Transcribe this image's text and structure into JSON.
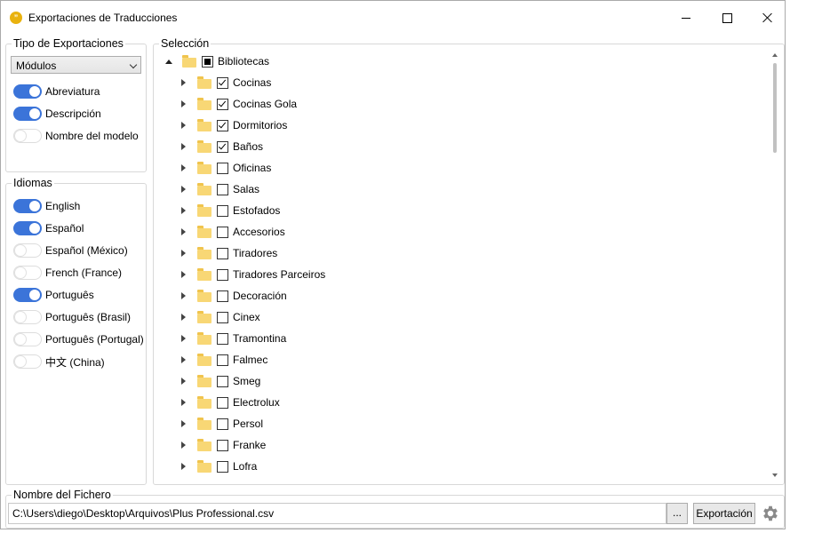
{
  "window": {
    "title": "Exportaciones de Traducciones",
    "icon": "quote-bubble-icon",
    "controls": {
      "minimize": "minimize-icon",
      "maximize": "maximize-icon",
      "close": "close-icon"
    }
  },
  "tipo": {
    "legend": "Tipo de Exportaciones",
    "select_value": "Módulos",
    "options": [
      {
        "label": "Abreviatura",
        "on": true
      },
      {
        "label": "Descripción",
        "on": true
      },
      {
        "label": "Nombre del modelo",
        "on": false
      }
    ]
  },
  "idiomas": {
    "legend": "Idiomas",
    "items": [
      {
        "label": "English",
        "on": true
      },
      {
        "label": "Español",
        "on": true
      },
      {
        "label": "Español (México)",
        "on": false
      },
      {
        "label": "French (France)",
        "on": false
      },
      {
        "label": "Português",
        "on": true
      },
      {
        "label": "Português (Brasil)",
        "on": false
      },
      {
        "label": "Português (Portugal)",
        "on": false
      },
      {
        "label": "中文 (China)",
        "on": false
      }
    ]
  },
  "seleccion": {
    "legend": "Selección",
    "root": {
      "label": "Bibliotecas",
      "state": "partial",
      "expanded": true
    },
    "items": [
      {
        "label": "Cocinas",
        "checked": true
      },
      {
        "label": "Cocinas Gola",
        "checked": true
      },
      {
        "label": "Dormitorios",
        "checked": true
      },
      {
        "label": "Baños",
        "checked": true
      },
      {
        "label": "Oficinas",
        "checked": false
      },
      {
        "label": "Salas",
        "checked": false
      },
      {
        "label": "Estofados",
        "checked": false
      },
      {
        "label": "Accesorios",
        "checked": false
      },
      {
        "label": "Tiradores",
        "checked": false
      },
      {
        "label": "Tiradores Parceiros",
        "checked": false
      },
      {
        "label": "Decoración",
        "checked": false
      },
      {
        "label": "Cinex",
        "checked": false
      },
      {
        "label": "Tramontina",
        "checked": false
      },
      {
        "label": "Falmec",
        "checked": false
      },
      {
        "label": "Smeg",
        "checked": false
      },
      {
        "label": "Electrolux",
        "checked": false
      },
      {
        "label": "Persol",
        "checked": false
      },
      {
        "label": "Franke",
        "checked": false
      },
      {
        "label": "Lofra",
        "checked": false
      }
    ]
  },
  "fichero": {
    "legend": "Nombre del Fichero",
    "path": "C:\\Users\\diego\\Desktop\\Arquivos\\Plus Professional.csv",
    "browse_label": "...",
    "export_label": "Exportación",
    "settings_icon": "gear-icon"
  },
  "colors": {
    "toggle_on": "#3b74d9",
    "folder": "#f8d775",
    "app_icon": "#e9b20e"
  }
}
